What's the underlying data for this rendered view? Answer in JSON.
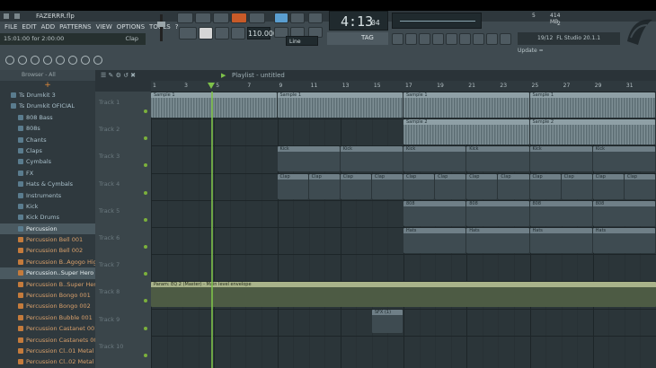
{
  "window": {
    "title": "FAZERRR.flp"
  },
  "menu": [
    "FILE",
    "EDIT",
    "ADD",
    "PATTERNS",
    "VIEW",
    "OPTIONS",
    "TOOLS",
    "?"
  ],
  "hint": {
    "text": "15:01:00 for 2:00:00",
    "right": "Clap"
  },
  "transport": {
    "time": "4:13",
    "time_ms": "04",
    "tempo": "110.000",
    "pat_label": "Line"
  },
  "status": {
    "tag": "TAG",
    "mem": "414 MB",
    "cpu": "5",
    "voices": "2",
    "news_date": "19/12",
    "news": "FL Studio 20.1.1 Update ="
  },
  "browser": {
    "title": "Browser - All",
    "items": [
      {
        "label": "Ts Drumkit 3",
        "type": "folder",
        "indent": 1
      },
      {
        "label": "Ts Drumkit OFICIAL",
        "type": "folder",
        "indent": 1
      },
      {
        "label": "808 Bass",
        "type": "folder",
        "indent": 2
      },
      {
        "label": "808s",
        "type": "folder",
        "indent": 2
      },
      {
        "label": "Chants",
        "type": "folder",
        "indent": 2
      },
      {
        "label": "Claps",
        "type": "folder",
        "indent": 2
      },
      {
        "label": "Cymbals",
        "type": "folder",
        "indent": 2
      },
      {
        "label": "FX",
        "type": "folder",
        "indent": 2
      },
      {
        "label": "Hats & Cymbals",
        "type": "folder",
        "indent": 2
      },
      {
        "label": "Instruments",
        "type": "folder",
        "indent": 2
      },
      {
        "label": "Kick",
        "type": "folder",
        "indent": 2
      },
      {
        "label": "Kick Drums",
        "type": "folder",
        "indent": 2
      },
      {
        "label": "Percussion",
        "type": "folder",
        "indent": 2,
        "selected": true
      },
      {
        "label": "Percussion Bell 001",
        "type": "file",
        "indent": 2
      },
      {
        "label": "Percussion Bell 002",
        "type": "file",
        "indent": 2
      },
      {
        "label": "Percussion B..Agogo High",
        "type": "file",
        "indent": 2
      },
      {
        "label": "Percussion..Super Hero",
        "type": "file",
        "indent": 2,
        "selected": true
      },
      {
        "label": "Percussion B..Super Hero",
        "type": "file",
        "indent": 2
      },
      {
        "label": "Percussion Bongo 001",
        "type": "file",
        "indent": 2
      },
      {
        "label": "Percussion Bongo 002",
        "type": "file",
        "indent": 2
      },
      {
        "label": "Percussion Bubble 001",
        "type": "file",
        "indent": 2
      },
      {
        "label": "Percussion Castanet 001",
        "type": "file",
        "indent": 2
      },
      {
        "label": "Percussion Castanets 002",
        "type": "file",
        "indent": 2
      },
      {
        "label": "Percussion Cl..01 Metal FX",
        "type": "file",
        "indent": 2
      },
      {
        "label": "Percussion Cl..02 Metal FX",
        "type": "file",
        "indent": 2
      }
    ]
  },
  "playlist": {
    "title": "Playlist - untitled",
    "bars": [
      "1",
      "3",
      "5",
      "7",
      "9",
      "11",
      "13",
      "15",
      "17",
      "19",
      "21",
      "23",
      "25",
      "27",
      "29",
      "31"
    ],
    "tracks": [
      "Track 1",
      "Track 2",
      "Track 3",
      "Track 4",
      "Track 5",
      "Track 6",
      "Track 7",
      "Track 8",
      "Track 9",
      "Track 10"
    ]
  },
  "clips": {
    "sample1": "Sample 1",
    "sample2": "Sample 2",
    "kick": "Kick",
    "clap": "Clap",
    "s808": "808",
    "hats": "Hats",
    "auto": "Param: EQ 2 (Master) - Main level envelope",
    "sfx": "SFX (1)"
  }
}
